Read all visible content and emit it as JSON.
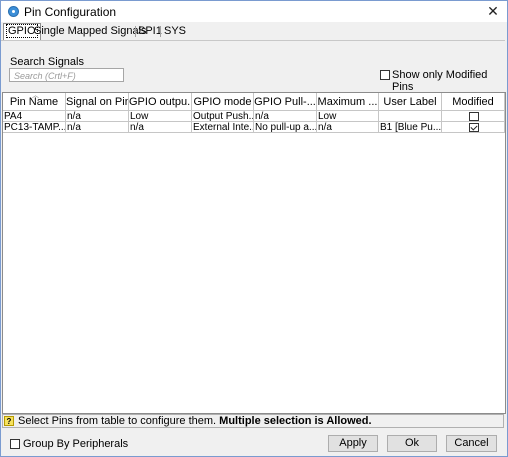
{
  "window": {
    "title": "Pin Configuration",
    "close_glyph": "✕"
  },
  "tabs": [
    {
      "label": "GPIO",
      "active": true
    },
    {
      "label": "Single Mapped Signals",
      "active": false
    },
    {
      "label": "SPI1",
      "active": false
    },
    {
      "label": "SYS",
      "active": false
    }
  ],
  "search": {
    "label": "Search Signals",
    "placeholder": "Search (Crtl+F)"
  },
  "show_modified": {
    "label": "Show only Modified Pins",
    "checked": false
  },
  "table": {
    "columns": [
      "Pin Name",
      "Signal on Pin",
      "GPIO outpu...",
      "GPIO mode",
      "GPIO Pull-...",
      "Maximum ...",
      "User Label",
      "Modified"
    ],
    "rows": [
      {
        "pin": "PA4",
        "signal": "n/a",
        "output": "Low",
        "mode": "Output Push...",
        "pull": "n/a",
        "maximum": "Low",
        "label": "",
        "modified": false
      },
      {
        "pin": "PC13-TAMP...",
        "signal": "n/a",
        "output": "n/a",
        "mode": "External Inte...",
        "pull": "No pull-up a...",
        "maximum": "n/a",
        "label": "B1 [Blue Pu...",
        "modified": true
      }
    ]
  },
  "status": {
    "icon": "?",
    "text": "Select Pins from table to configure them. ",
    "bold": "Multiple selection is Allowed."
  },
  "group_by": {
    "label": "Group By Peripherals",
    "checked": false
  },
  "buttons": {
    "apply": "Apply",
    "ok": "Ok",
    "cancel": "Cancel"
  },
  "colors": {
    "accent": "#3c8fd8",
    "help_icon": "#f6e25e"
  }
}
